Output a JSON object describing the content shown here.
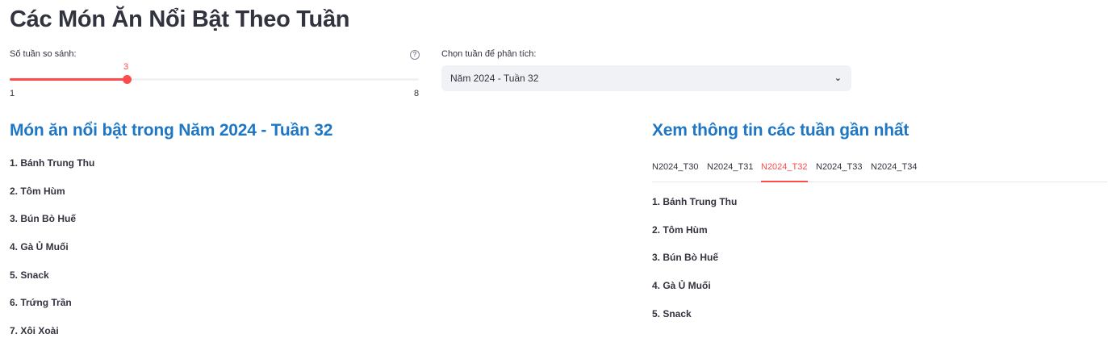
{
  "page": {
    "title": "Các Món Ăn Nổi Bật Theo Tuần"
  },
  "slider": {
    "label": "Số tuần so sánh:",
    "value": "3",
    "min": "1",
    "max": "8",
    "help_icon": "help-circle-icon"
  },
  "select": {
    "label": "Chọn tuần để phân tích:",
    "value": "Năm 2024 - Tuần 32",
    "chevron": "⌄"
  },
  "left": {
    "heading": "Món ăn nổi bật trong Năm 2024 - Tuần 32",
    "items": [
      "1. Bánh Trung Thu",
      "2. Tôm Hùm",
      "3. Bún Bò Huế",
      "4. Gà Ủ Muối",
      "5. Snack",
      "6. Trứng Trần",
      "7. Xôi Xoài"
    ]
  },
  "right": {
    "heading": "Xem thông tin các tuần gần nhất",
    "tabs": [
      "N2024_T30",
      "N2024_T31",
      "N2024_T32",
      "N2024_T33",
      "N2024_T34"
    ],
    "active_tab": "N2024_T32",
    "items": [
      "1. Bánh Trung Thu",
      "2. Tôm Hùm",
      "3. Bún Bò Huế",
      "4. Gà Ủ Muối",
      "5. Snack"
    ]
  },
  "colors": {
    "accent": "#ff4b4b",
    "heading_blue": "#1f77c4",
    "text": "#31333f",
    "input_bg": "#f0f2f6"
  }
}
